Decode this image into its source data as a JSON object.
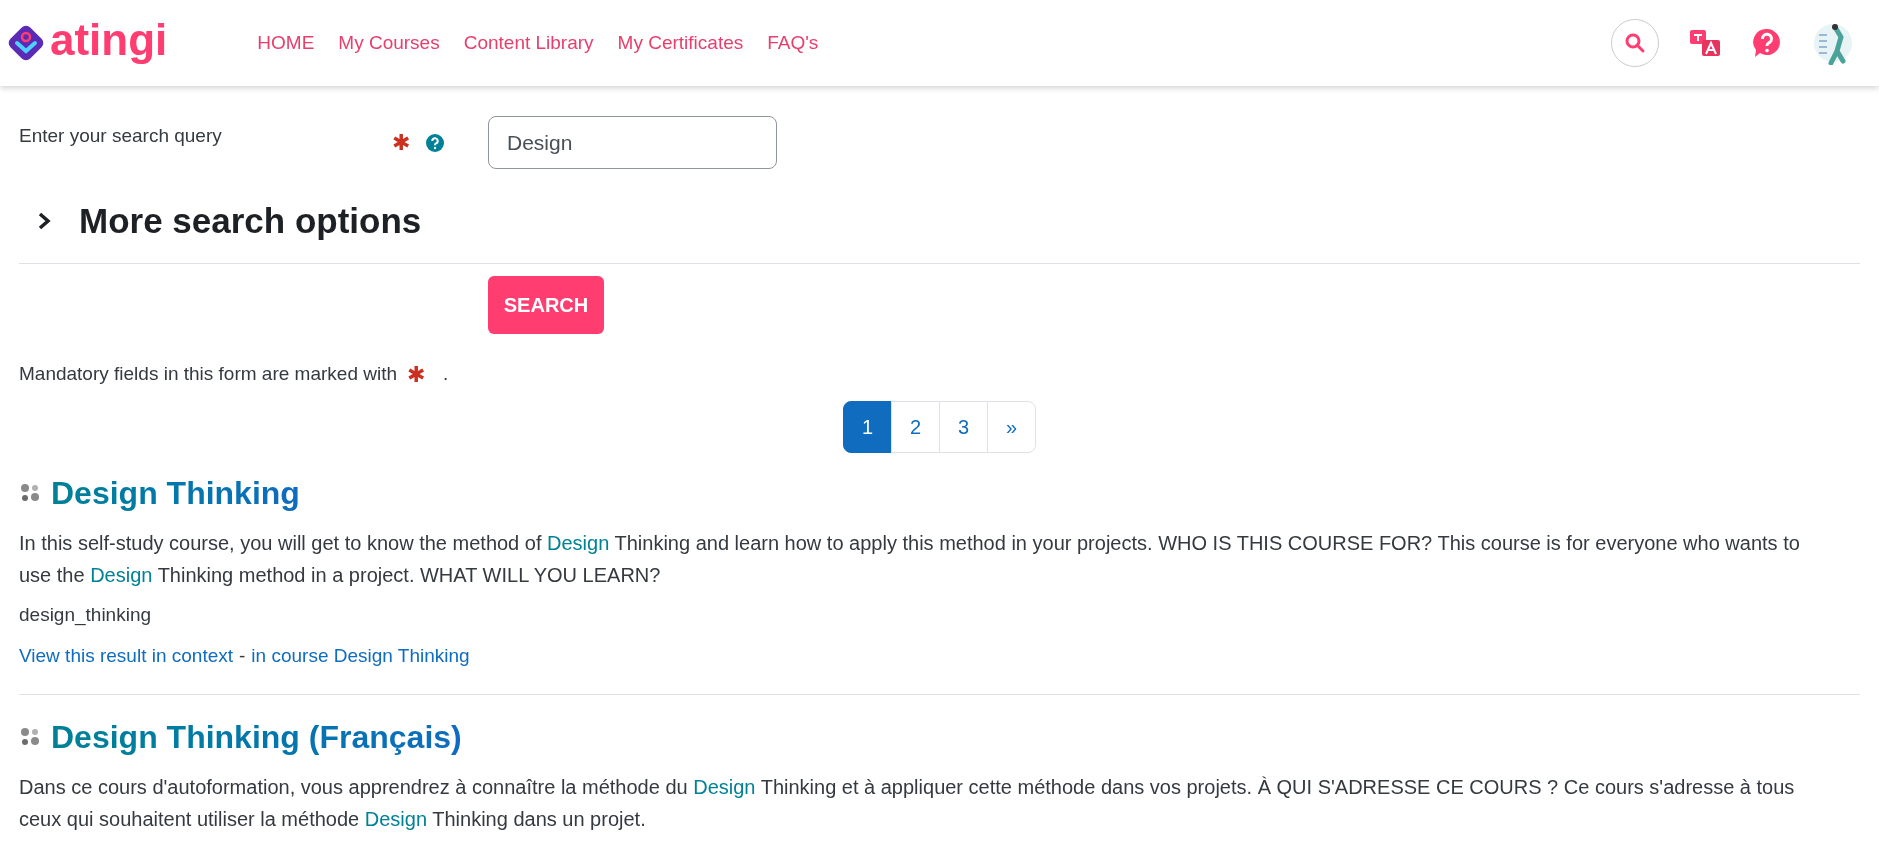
{
  "header": {
    "logo_text": "atingi",
    "nav": [
      {
        "label": "HOME"
      },
      {
        "label": "My Courses"
      },
      {
        "label": "Content Library"
      },
      {
        "label": "My Certificates"
      },
      {
        "label": "FAQ's"
      }
    ]
  },
  "search_form": {
    "label": "Enter your search query",
    "required_mark": "✱",
    "value": "Design",
    "more_options": {
      "label": "More search options",
      "expanded": false
    },
    "button": "SEARCH",
    "note_before": "Mandatory fields in this form are marked with",
    "note_mark": "✱",
    "note_after": "."
  },
  "pagination": [
    {
      "label": "1",
      "selected": true
    },
    {
      "label": "2",
      "selected": false
    },
    {
      "label": "3",
      "selected": false
    },
    {
      "label": "»",
      "selected": false
    }
  ],
  "results": [
    {
      "title": "Design Thinking",
      "description": [
        {
          "text": "In this self-study course, you will get to know the method of ",
          "highlight": false
        },
        {
          "text": "Design",
          "highlight": true
        },
        {
          "text": " Thinking and learn how to apply this method in your projects. WHO IS THIS COURSE FOR? This course is for everyone who wants to use the ",
          "highlight": false
        },
        {
          "text": "Design",
          "highlight": true
        },
        {
          "text": " Thinking method in a project. WHAT WILL YOU LEARN?",
          "highlight": false
        }
      ],
      "shortname": "design_thinking",
      "context_link": "View this result in context",
      "separator": "-",
      "course_link": "in course Design Thinking"
    },
    {
      "title": "Design Thinking (Français)",
      "description": [
        {
          "text": "Dans ce cours d'autoformation, vous apprendrez à connaître la méthode du ",
          "highlight": false
        },
        {
          "text": "Design",
          "highlight": true
        },
        {
          "text": " Thinking et à appliquer cette méthode dans vos projets. À QUI S'ADRESSE CE COURS ? Ce cours s'adresse à tous ceux qui souhaitent utiliser la méthode ",
          "highlight": false
        },
        {
          "text": "Design",
          "highlight": true
        },
        {
          "text": " Thinking dans un projet.",
          "highlight": false
        }
      ]
    }
  ]
}
